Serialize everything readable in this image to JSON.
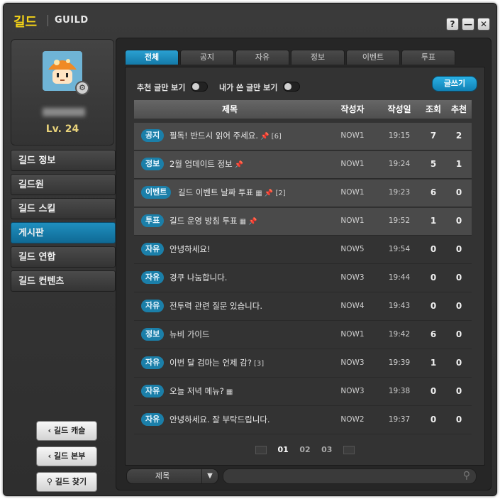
{
  "window": {
    "title_ko": "길드",
    "title_en": "GUILD",
    "help": "?",
    "minimize": "—",
    "close": "✕"
  },
  "profile": {
    "level": "Lv. 24",
    "settings_icon": "gear-icon"
  },
  "menu": [
    {
      "label": "길드 정보",
      "active": false
    },
    {
      "label": "길드원",
      "active": false
    },
    {
      "label": "길드 스킬",
      "active": false
    },
    {
      "label": "게시판",
      "active": true
    },
    {
      "label": "길드 연합",
      "active": false
    },
    {
      "label": "길드 컨텐츠",
      "active": false
    }
  ],
  "bottom_buttons": {
    "castle": "길드 캐슬",
    "hq": "길드 본부",
    "find": "길드 찾기"
  },
  "tabs": [
    {
      "label": "전체",
      "active": true
    },
    {
      "label": "공지",
      "active": false
    },
    {
      "label": "자유",
      "active": false
    },
    {
      "label": "정보",
      "active": false
    },
    {
      "label": "이벤트",
      "active": false
    },
    {
      "label": "투표",
      "active": false
    }
  ],
  "filters": {
    "recommended": "추천 글만 보기",
    "mine": "내가 쓴 글만 보기",
    "write": "글쓰기"
  },
  "columns": {
    "title": "제목",
    "author": "작성자",
    "date": "작성일",
    "views": "조회",
    "likes": "추천"
  },
  "posts": [
    {
      "tag": "공지",
      "title": "필독! 반드시 읽어 주세요.",
      "icons": "📌 [6]",
      "author": "NOW1",
      "time": "19:15",
      "views": "7",
      "likes": "2",
      "pinned": true
    },
    {
      "tag": "정보",
      "title": "2월 업데이트 정보",
      "icons": "📌",
      "author": "NOW1",
      "time": "19:24",
      "views": "5",
      "likes": "1",
      "pinned": true
    },
    {
      "tag": "이벤트",
      "title": "길드 이벤트 날짜 투표",
      "icons": "▦ 📌 [2]",
      "author": "NOW1",
      "time": "19:23",
      "views": "6",
      "likes": "0",
      "pinned": true
    },
    {
      "tag": "투표",
      "title": "길드 운영 방침 투표",
      "icons": "▦ 📌",
      "author": "NOW1",
      "time": "19:52",
      "views": "1",
      "likes": "0",
      "pinned": true
    },
    {
      "tag": "자유",
      "title": "안녕하세요!",
      "icons": "",
      "author": "NOW5",
      "time": "19:54",
      "views": "0",
      "likes": "0",
      "pinned": false
    },
    {
      "tag": "자유",
      "title": "경쿠 나눔합니다.",
      "icons": "",
      "author": "NOW3",
      "time": "19:44",
      "views": "0",
      "likes": "0",
      "pinned": false
    },
    {
      "tag": "자유",
      "title": "전투력 관련 질문 있습니다.",
      "icons": "",
      "author": "NOW4",
      "time": "19:43",
      "views": "0",
      "likes": "0",
      "pinned": false
    },
    {
      "tag": "정보",
      "title": "뉴비 가이드",
      "icons": "",
      "author": "NOW1",
      "time": "19:42",
      "views": "6",
      "likes": "0",
      "pinned": false
    },
    {
      "tag": "자유",
      "title": "이번 달 검마는 언제 감?",
      "icons": "[3]",
      "author": "NOW3",
      "time": "19:39",
      "views": "1",
      "likes": "0",
      "pinned": false
    },
    {
      "tag": "자유",
      "title": "오늘 저녁 메뉴?",
      "icons": "▦",
      "author": "NOW3",
      "time": "19:38",
      "views": "0",
      "likes": "0",
      "pinned": false
    },
    {
      "tag": "자유",
      "title": "안녕하세요. 잘 부탁드립니다.",
      "icons": "",
      "author": "NOW2",
      "time": "19:37",
      "views": "0",
      "likes": "0",
      "pinned": false
    }
  ],
  "pagination": {
    "pages": [
      "01",
      "02",
      "03"
    ],
    "current": "01"
  },
  "search": {
    "type": "제목",
    "placeholder": ""
  },
  "colors": {
    "accent": "#1b7fa9",
    "title": "#f5d418",
    "active_menu": "#1380b0"
  }
}
